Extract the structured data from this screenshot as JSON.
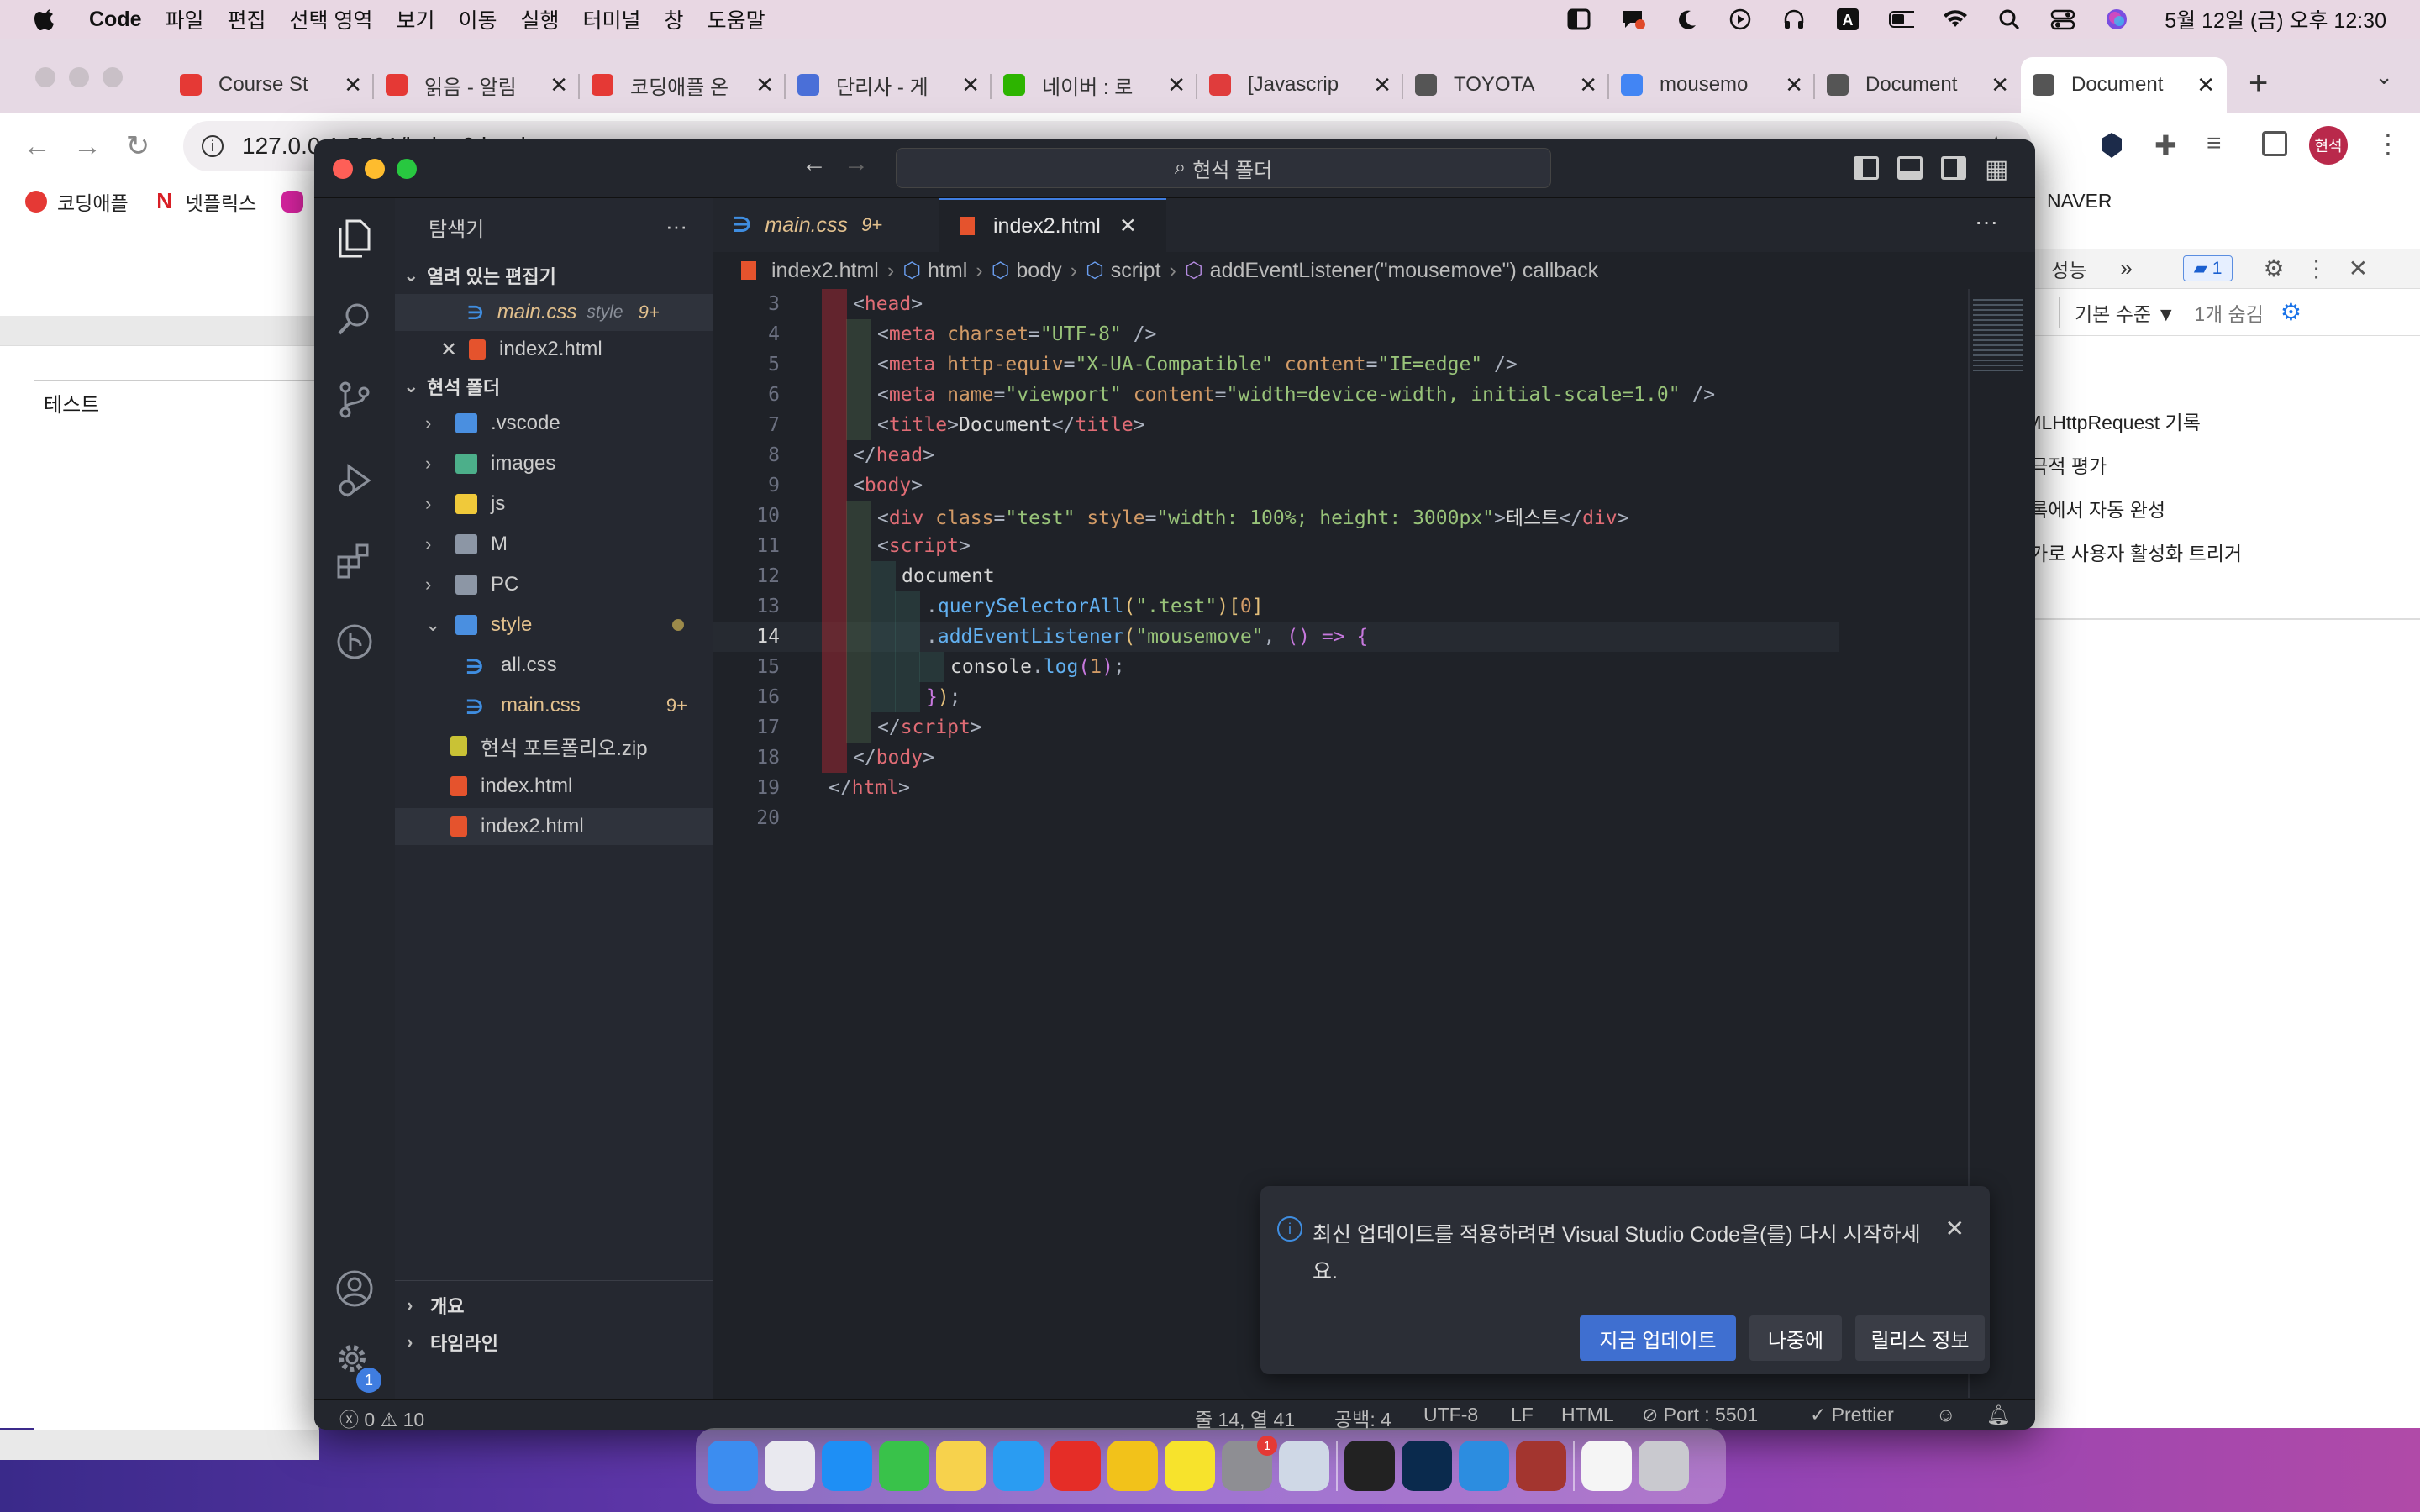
{
  "menubar": {
    "items": [
      "Code",
      "파일",
      "편집",
      "선택 영역",
      "보기",
      "이동",
      "실행",
      "터미널",
      "창",
      "도움말"
    ],
    "clock": "5월 12일 (금) 오후 12:30"
  },
  "chrome": {
    "tabs": [
      {
        "title": "Course St",
        "color": "#e53935"
      },
      {
        "title": "읽음 - 알림",
        "color": "#e53935"
      },
      {
        "title": "코딩애플 온",
        "color": "#e53935"
      },
      {
        "title": "단리사 - 게",
        "color": "#4a6fd8"
      },
      {
        "title": "네이버 : 로",
        "color": "#2db400"
      },
      {
        "title": "[Javascrip",
        "color": "#e03c3c"
      },
      {
        "title": "TOYOTA",
        "color": "#555555"
      },
      {
        "title": "mousemo",
        "color": "#4285f4"
      },
      {
        "title": "Document",
        "color": "#555555"
      },
      {
        "title": "Document",
        "color": "#555555"
      }
    ],
    "url": "127.0.0.1:5501/index2.html",
    "bookmarks": [
      {
        "label": "코딩애플",
        "color": "#e53935"
      },
      {
        "label": "넷플릭스",
        "color": "#d81f26"
      },
      {
        "label": "",
        "color": "#d6249f"
      }
    ],
    "bookmark_right": "NAVER",
    "profile": "현석"
  },
  "page": {
    "text": "테스트"
  },
  "devtools": {
    "tab_perf": "성능",
    "badge": "1",
    "level": "기본 수준 ▼",
    "hidden": "1개 숨김",
    "options": [
      "XMLHttpRequest 기록",
      "적극적 평가",
      "기록에서 자동 완성",
      "평가로 사용자 활성화 트리거"
    ]
  },
  "vscode": {
    "search": "현석 폴더",
    "explorer_title": "탐색기",
    "open_editors": "열려 있는 편집기",
    "open_files": [
      {
        "name": "main.css",
        "desc": "style",
        "badge": "9+"
      },
      {
        "name": "index2.html",
        "desc": "",
        "badge": ""
      }
    ],
    "folder": "현석 폴더",
    "tree": [
      {
        "name": ".vscode",
        "kind": "folder",
        "color": "#4a8fe0"
      },
      {
        "name": "images",
        "kind": "folder",
        "color": "#4caf8a"
      },
      {
        "name": "js",
        "kind": "folder",
        "color": "#f0c93a"
      },
      {
        "name": "M",
        "kind": "folder",
        "color": "#8c96a5"
      },
      {
        "name": "PC",
        "kind": "folder",
        "color": "#8c96a5"
      },
      {
        "name": "style",
        "kind": "folder-open",
        "color": "#4a8fe0"
      },
      {
        "name": "all.css",
        "kind": "css",
        "color": "#3f8de0"
      },
      {
        "name": "main.css",
        "kind": "css",
        "color": "#3f8de0",
        "badge": "9+"
      },
      {
        "name": "현석 포트폴리오.zip",
        "kind": "zip",
        "color": "#c9c235"
      },
      {
        "name": "index.html",
        "kind": "html",
        "color": "#e5532d"
      },
      {
        "name": "index2.html",
        "kind": "html",
        "color": "#e5532d"
      }
    ],
    "outline": "개요",
    "timeline": "타임라인",
    "tabs": [
      {
        "name": "main.css",
        "badge": "9+"
      },
      {
        "name": "index2.html",
        "badge": ""
      }
    ],
    "breadcrumbs": [
      "index2.html",
      "html",
      "body",
      "script",
      "addEventListener(\"mousemove\") callback"
    ],
    "code_lines": [
      {
        "n": "3",
        "html": "<span class='pun'>&lt;</span><span class='tag'>head</span><span class='pun'>&gt;</span>",
        "indent": 1
      },
      {
        "n": "4",
        "html": "<span class='pun'>&lt;</span><span class='tag'>meta</span> <span class='att'>charset</span><span class='pun'>=</span><span class='str'>\"UTF-8\"</span> <span class='pun'>/&gt;</span>",
        "indent": 2
      },
      {
        "n": "5",
        "html": "<span class='pun'>&lt;</span><span class='tag'>meta</span> <span class='att'>http-equiv</span><span class='pun'>=</span><span class='str'>\"X-UA-Compatible\"</span> <span class='att'>content</span><span class='pun'>=</span><span class='str'>\"IE=edge\"</span> <span class='pun'>/&gt;</span>",
        "indent": 2
      },
      {
        "n": "6",
        "html": "<span class='pun'>&lt;</span><span class='tag'>meta</span> <span class='att'>name</span><span class='pun'>=</span><span class='str'>\"viewport\"</span> <span class='att'>content</span><span class='pun'>=</span><span class='str'>\"width=device-width, initial-scale=1.0\"</span> <span class='pun'>/&gt;</span>",
        "indent": 2
      },
      {
        "n": "7",
        "html": "<span class='pun'>&lt;</span><span class='tag'>title</span><span class='pun'>&gt;</span><span class='txt'>Document</span><span class='pun'>&lt;/</span><span class='tag'>title</span><span class='pun'>&gt;</span>",
        "indent": 2
      },
      {
        "n": "8",
        "html": "<span class='pun'>&lt;/</span><span class='tag'>head</span><span class='pun'>&gt;</span>",
        "indent": 1
      },
      {
        "n": "9",
        "html": "<span class='pun'>&lt;</span><span class='tag'>body</span><span class='pun'>&gt;</span>",
        "indent": 1
      },
      {
        "n": "10",
        "html": "<span class='pun'>&lt;</span><span class='tag'>div</span> <span class='att'>class</span><span class='pun'>=</span><span class='str'>\"test\"</span> <span class='att'>style</span><span class='pun'>=</span><span class='str'>\"width: 100%; height: 3000px\"</span><span class='pun'>&gt;</span><span class='txt'>테스트</span><span class='pun'>&lt;/</span><span class='tag'>div</span><span class='pun'>&gt;</span>",
        "indent": 2
      },
      {
        "n": "11",
        "html": "<span class='pun'>&lt;</span><span class='tag'>script</span><span class='pun'>&gt;</span>",
        "indent": 2
      },
      {
        "n": "12",
        "html": "<span class='txt'>document</span>",
        "indent": 3
      },
      {
        "n": "13",
        "html": "<span class='pun'>.</span><span class='fn'>querySelectorAll</span><span class='br'>(</span><span class='str'>\".test\"</span><span class='br'>)[</span><span class='num'>0</span><span class='br'>]</span>",
        "indent": 4
      },
      {
        "n": "14",
        "html": "<span class='pun'>.</span><span class='fn'>addEventListener</span><span class='br'>(</span><span class='str'>\"mousemove\"</span><span class='pun'>, </span><span class='kw'>()</span> <span class='kw'>=&gt;</span> <span class='kw'>{</span>",
        "indent": 4
      },
      {
        "n": "15",
        "html": "<span class='txt'>console</span><span class='pun'>.</span><span class='fn'>log</span><span class='kw'>(</span><span class='num'>1</span><span class='kw'>)</span><span class='pun'>;</span>",
        "indent": 5
      },
      {
        "n": "16",
        "html": "<span class='kw'>}</span><span class='br'>)</span><span class='pun'>;</span>",
        "indent": 4
      },
      {
        "n": "17",
        "html": "<span class='pun'>&lt;/</span><span class='tag'>script</span><span class='pun'>&gt;</span>",
        "indent": 2
      },
      {
        "n": "18",
        "html": "<span class='pun'>&lt;/</span><span class='tag'>body</span><span class='pun'>&gt;</span>",
        "indent": 1
      },
      {
        "n": "19",
        "html": "<span class='pun'>&lt;/</span><span class='tag'>html</span><span class='pun'>&gt;</span>",
        "indent": 0
      },
      {
        "n": "20",
        "html": "",
        "indent": 0
      }
    ],
    "current_line": "14",
    "notification": {
      "message": "최신 업데이트를 적용하려면 Visual Studio Code을(를) 다시 시작하세요.",
      "update_now": "지금 업데이트",
      "later": "나중에",
      "release_notes": "릴리스 정보"
    },
    "status": {
      "errors": "0",
      "warnings": "10",
      "position": "줄 14, 열 41",
      "spaces": "공백: 4",
      "encoding": "UTF-8",
      "eol": "LF",
      "language": "HTML",
      "port": "Port : 5501",
      "prettier": "Prettier"
    },
    "settings_badge": "1"
  },
  "dock": {
    "icons": [
      {
        "name": "finder",
        "color": "#3c8df0"
      },
      {
        "name": "launchpad",
        "color": "#e9e9ef"
      },
      {
        "name": "app-store",
        "color": "#1e8ff5"
      },
      {
        "name": "facetime",
        "color": "#39c24a"
      },
      {
        "name": "notes",
        "color": "#f7d24c"
      },
      {
        "name": "safari",
        "color": "#2a9cf2"
      },
      {
        "name": "youtube-music",
        "color": "#e52d27"
      },
      {
        "name": "chrome",
        "color": "#f2c21a"
      },
      {
        "name": "kakaotalk",
        "color": "#f7e32c"
      },
      {
        "name": "system-preferences",
        "color": "#8e8e93"
      },
      {
        "name": "preview",
        "color": "#cfd8e6"
      },
      {
        "name": "terminal",
        "color": "#222222"
      },
      {
        "name": "photoshop",
        "color": "#0a2a4d"
      },
      {
        "name": "vscode",
        "color": "#2c8de0"
      },
      {
        "name": "dictionary",
        "color": "#a3352f"
      },
      {
        "name": "documents",
        "color": "#f5f5f5"
      },
      {
        "name": "trash",
        "color": "#c9c9cf"
      }
    ],
    "sysprefs_badge": "1"
  }
}
